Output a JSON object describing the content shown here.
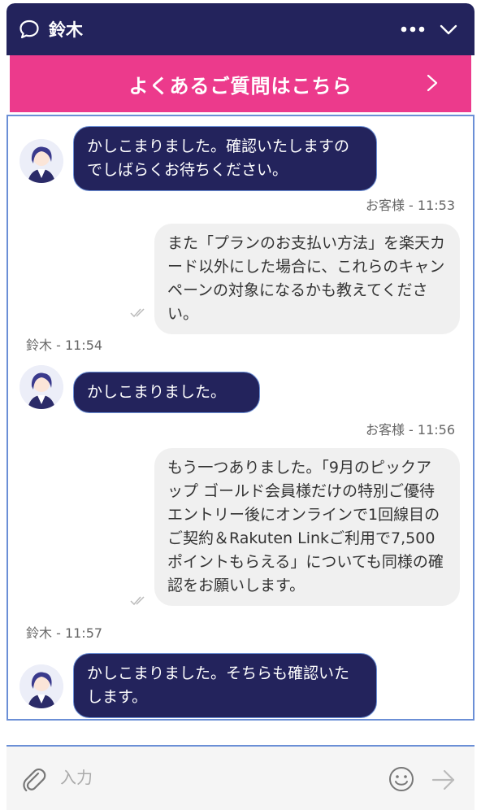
{
  "header": {
    "agent_name": "鈴木",
    "chat_icon": "chat-bubble-icon",
    "more_icon": "more-horizontal-icon",
    "collapse_icon": "chevron-down-icon"
  },
  "faq_banner": {
    "label": "よくあるご質問はこちら",
    "icon": "chevron-right-icon"
  },
  "messages": [
    {
      "sender": "agent",
      "text": "かしこまりました。確認いたしますのでしばらくお待ちください。"
    },
    {
      "sender": "customer",
      "meta": "お客様 - 11:53",
      "text": "また「プランのお支払い方法」を楽天カード以外にした場合に、これらのキャンペーンの対象になるかも教えてください。"
    },
    {
      "sender": "agent",
      "meta": "鈴木 - 11:54",
      "text": "かしこまりました。"
    },
    {
      "sender": "customer",
      "meta": "お客様 - 11:56",
      "text": "もう一つありました。「9月のピックアップ ゴールド会員様だけの特別ご優待 エントリー後にオンラインで1回線目のご契約＆Rakuten Linkご利用で7,500ポイントもらえる」についても同様の確認をお願いします。"
    },
    {
      "sender": "agent",
      "meta": "鈴木 - 11:57",
      "text": "かしこまりました。そちらも確認いたします。"
    }
  ],
  "input": {
    "placeholder": "入力",
    "value": ""
  },
  "colors": {
    "header_bg": "#23235c",
    "banner_bg": "#ec3a8c",
    "agent_bubble": "#23235c",
    "customer_bubble": "#f0f0f0",
    "accent_border": "#6b8fd6"
  }
}
